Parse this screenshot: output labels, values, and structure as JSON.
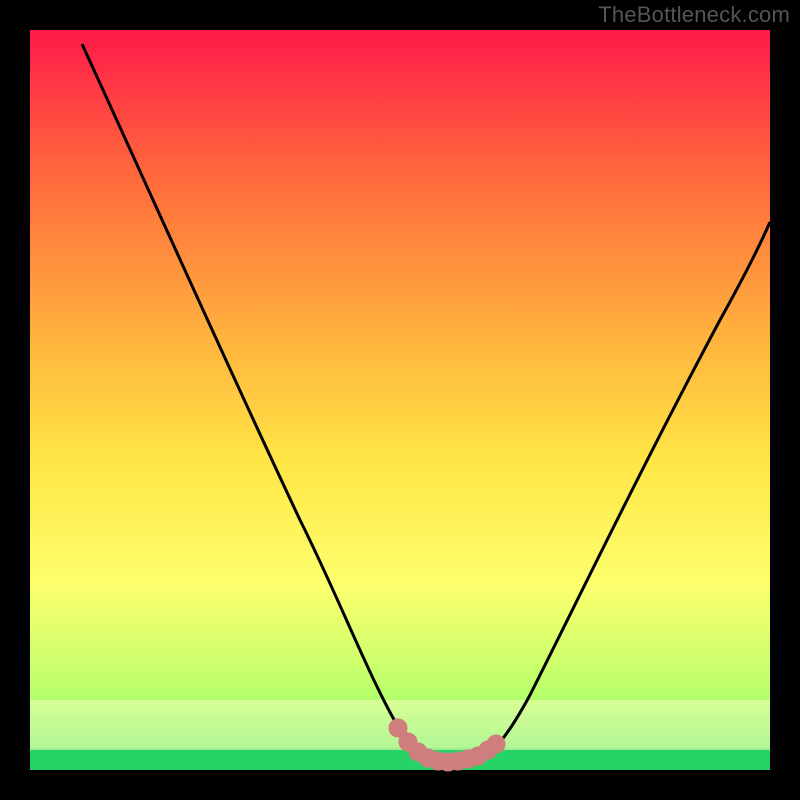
{
  "watermark": "TheBottleneck.com",
  "chart_data": {
    "type": "line",
    "title": "",
    "xlabel": "",
    "ylabel": "",
    "x_range": [
      0,
      100
    ],
    "y_range": [
      0,
      100
    ],
    "background_gradient_colors": [
      "#ff1a4a",
      "#ff6a3c",
      "#ffb43e",
      "#ffe545",
      "#fdff6e",
      "#b8ff6c",
      "#28e06a"
    ],
    "series": [
      {
        "name": "bottleneck-curve",
        "color": "#000000",
        "x": [
          7,
          15,
          25,
          35,
          42,
          46,
          49,
          52,
          54,
          58,
          62,
          67,
          75,
          85,
          95,
          99
        ],
        "y": [
          98,
          83,
          62,
          40,
          25,
          15,
          6,
          2,
          1,
          1,
          2,
          7,
          21,
          42,
          65,
          75
        ]
      },
      {
        "name": "highlight-region",
        "color": "#d38080",
        "x": [
          49,
          50.5,
          52,
          53.5,
          55,
          56.5,
          58,
          60,
          61,
          62
        ],
        "y": [
          6,
          3,
          2,
          1.3,
          1,
          1,
          1.2,
          1.6,
          2,
          2
        ]
      }
    ],
    "green_band_y_range": [
      0,
      3
    ]
  }
}
